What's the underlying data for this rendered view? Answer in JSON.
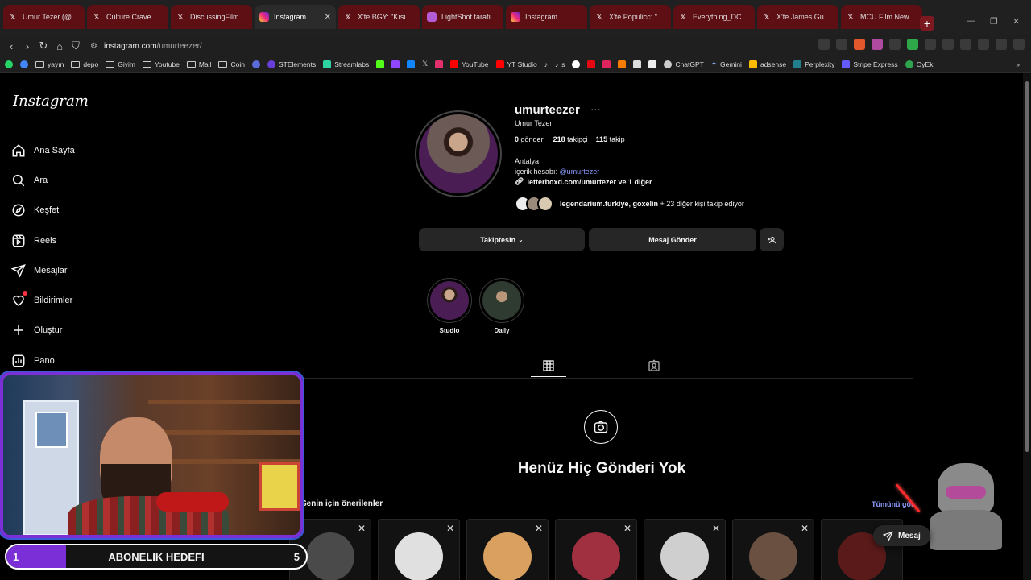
{
  "browser": {
    "tabs": [
      {
        "title": "Umur Tezer (@Umu",
        "icon": "x-icon"
      },
      {
        "title": "Culture Crave 🍿 (@",
        "icon": "x-icon"
      },
      {
        "title": "DiscussingFilm (@D",
        "icon": "x-icon"
      },
      {
        "title": "Instagram",
        "icon": "instagram-icon",
        "active": true
      },
      {
        "title": "X'te BGY: \"Kısıtlama",
        "icon": "x-icon"
      },
      {
        "title": "LightShot tarafından",
        "icon": "lightshot-icon"
      },
      {
        "title": "Instagram",
        "icon": "instagram-icon"
      },
      {
        "title": "X'te Populicc: \"Jame",
        "icon": "x-icon"
      },
      {
        "title": "Everything_DCU (@",
        "icon": "x-icon"
      },
      {
        "title": "X'te James Gunn: \"I",
        "icon": "x-icon"
      },
      {
        "title": "MCU Film News (@",
        "icon": "x-icon"
      }
    ],
    "url_host": "instagram.com",
    "url_path": "/umurteezer/",
    "bookmarks": [
      "yayın",
      "depo",
      "Giyim",
      "Youtube",
      "Mail",
      "Coin",
      "STElements",
      "Streamlabs",
      "YouTube",
      "YT Studio",
      "s",
      "ChatGPT",
      "Gemini",
      "adsense",
      "Perplexity",
      "Stripe Express",
      "OyEk"
    ]
  },
  "sidebar": {
    "logo": "Instagram",
    "items": [
      {
        "label": "Ana Sayfa",
        "icon": "home-icon"
      },
      {
        "label": "Ara",
        "icon": "search-icon"
      },
      {
        "label": "Keşfet",
        "icon": "compass-icon"
      },
      {
        "label": "Reels",
        "icon": "reels-icon"
      },
      {
        "label": "Mesajlar",
        "icon": "send-icon"
      },
      {
        "label": "Bildirimler",
        "icon": "heart-icon"
      },
      {
        "label": "Oluştur",
        "icon": "plus-icon"
      },
      {
        "label": "Pano",
        "icon": "chart-icon"
      }
    ]
  },
  "profile": {
    "username": "umurteezer",
    "more": "···",
    "full_name": "Umur Tezer",
    "posts_count": "0",
    "posts_label": "gönderi",
    "followers_count": "218",
    "followers_label": "takipçi",
    "following_count": "115",
    "following_label": "takip",
    "bio_line1": "Antalya",
    "bio_line2_prefix": "içerik hesabı:",
    "bio_mention": "@umurtezer",
    "link": "letterboxd.com/umurtezer ve 1 diğer",
    "followed_by_names": "legendarium.turkiye, goxelin",
    "followed_by_suffix": " + 23 diğer kişi takip ediyor",
    "follow_button": "Takiptesin",
    "message_button": "Mesaj Gönder",
    "highlights": [
      {
        "label": "Studio"
      },
      {
        "label": "Daily"
      }
    ]
  },
  "content": {
    "empty_title": "Henüz Hiç Gönderi Yok",
    "suggestions_title": "Senin için önerilenler",
    "see_all": "Tümünü gör"
  },
  "overlay": {
    "goal_label": "ABONELIK HEDEFI",
    "goal_current": "1",
    "goal_target": "5",
    "goal_progress": 0.2,
    "message_button": "Mesaj"
  },
  "colors": {
    "accent_purple": "#7b2fd6",
    "link_blue": "#8c9bff",
    "tab_red": "#5e0f14",
    "notification_red": "#ff3040"
  }
}
